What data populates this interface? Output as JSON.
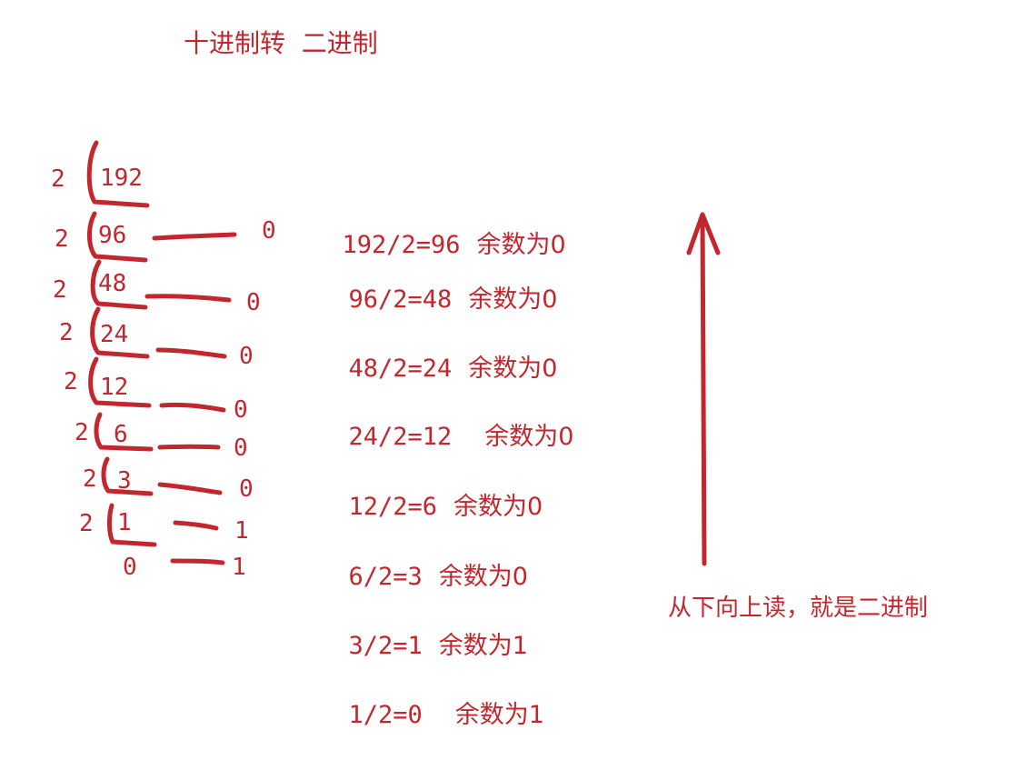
{
  "title": "十进制转  二进制",
  "read_hint": "从下向上读，就是二进制",
  "divisor": "2",
  "quotients": [
    "192",
    "96",
    "48",
    "24",
    "12",
    "6",
    "3",
    "1",
    "0"
  ],
  "remainders": [
    "0",
    "0",
    "0",
    "0",
    "0",
    "0",
    "1",
    "1"
  ],
  "equations": [
    {
      "expr": "192/2=96",
      "rem": "余数为0"
    },
    {
      "expr": "96/2=48",
      "rem": "余数为0"
    },
    {
      "expr": "48/2=24",
      "rem": "余数为0"
    },
    {
      "expr": "24/2=12",
      "rem": "余数为0"
    },
    {
      "expr": "12/2=6",
      "rem": "余数为0"
    },
    {
      "expr": "6/2=3",
      "rem": "余数为0"
    },
    {
      "expr": "3/2=1",
      "rem": "余数为1"
    },
    {
      "expr": "1/2=0",
      "rem": "余数为1"
    }
  ],
  "colors": {
    "ink": "#c1272d",
    "background": "#ffffff"
  }
}
